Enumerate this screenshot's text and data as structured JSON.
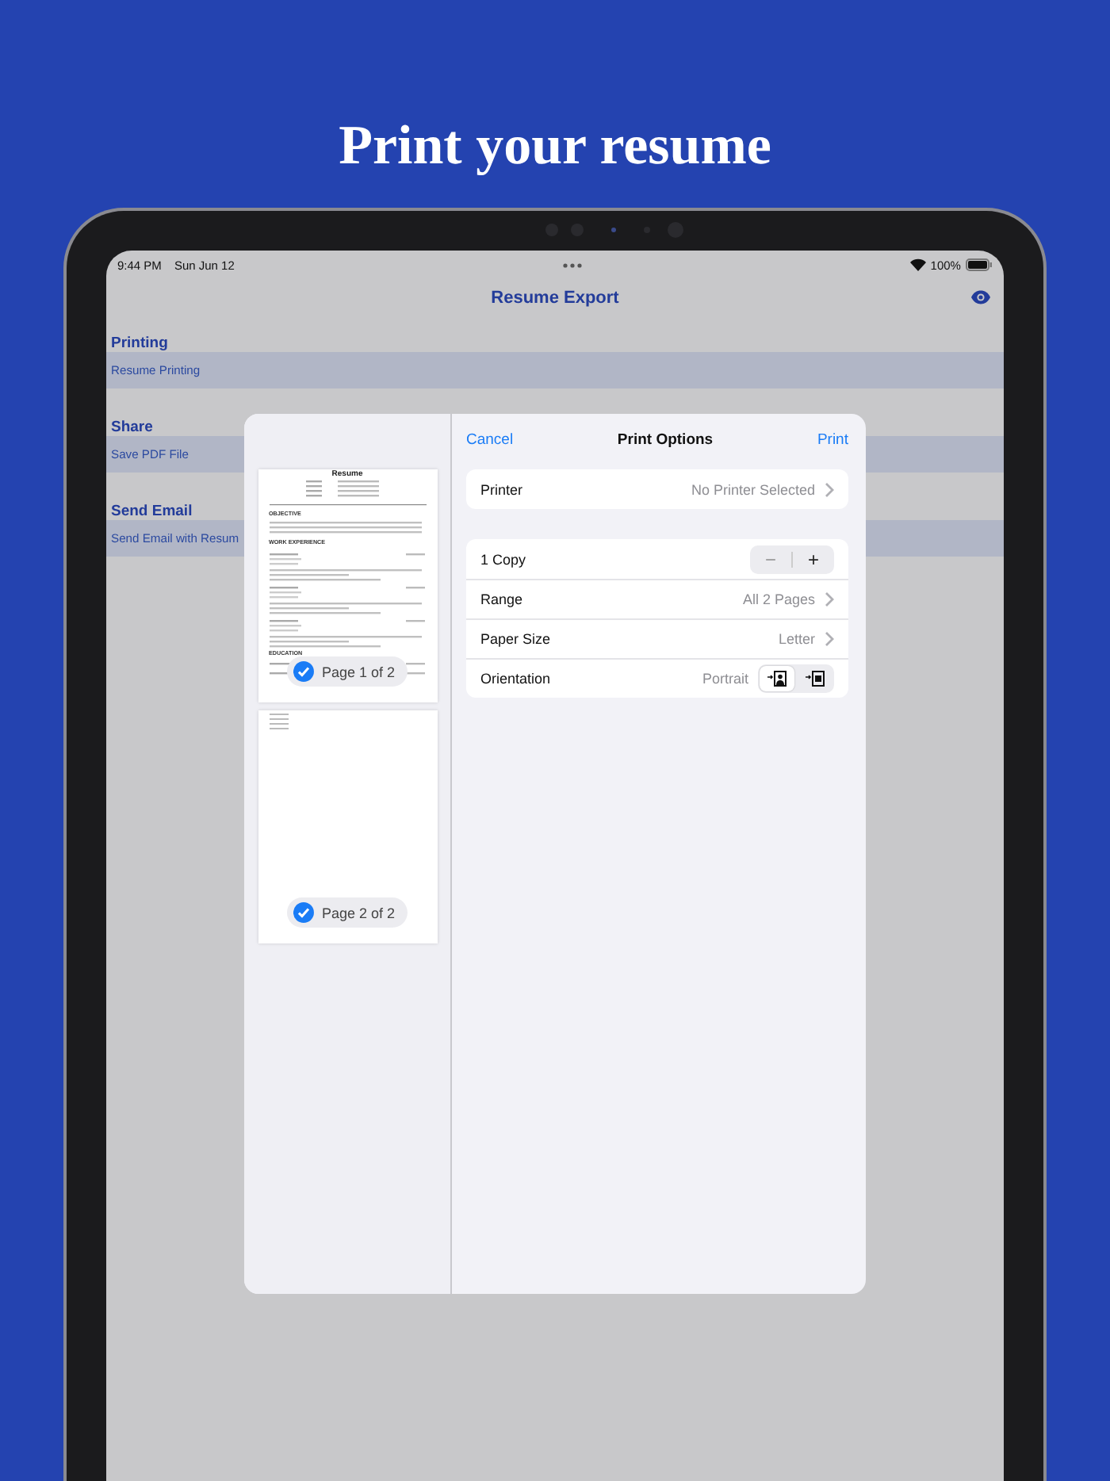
{
  "headline": "Print your resume",
  "status_bar": {
    "time": "9:44 PM",
    "date": "Sun Jun 12",
    "battery": "100%"
  },
  "nav": {
    "title": "Resume Export"
  },
  "sections": [
    {
      "header": "Printing",
      "rows": [
        {
          "label": "Resume Printing"
        }
      ]
    },
    {
      "header": "Share",
      "rows": [
        {
          "label": "Save PDF File"
        }
      ]
    },
    {
      "header": "Send Email",
      "rows": [
        {
          "label": "Send Email with Resum"
        }
      ]
    }
  ],
  "print_sheet": {
    "cancel": "Cancel",
    "title": "Print Options",
    "action": "Print",
    "pages": [
      {
        "kind": "resume",
        "label": "Page 1 of 2",
        "checked": true,
        "title": "Resume",
        "headings": [
          "OBJECTIVE",
          "WORK EXPERIENCE",
          "EDUCATION"
        ]
      },
      {
        "kind": "list",
        "label": "Page 2 of 2",
        "checked": true
      }
    ],
    "printer": {
      "label": "Printer",
      "value": "No Printer Selected"
    },
    "options": [
      {
        "kind": "stepper",
        "label": "1 Copy",
        "decrement": "−",
        "increment": "+"
      },
      {
        "kind": "link",
        "label": "Range",
        "value": "All 2 Pages"
      },
      {
        "kind": "link",
        "label": "Paper Size",
        "value": "Letter"
      },
      {
        "kind": "orientation",
        "label": "Orientation",
        "value": "Portrait",
        "choices": [
          {
            "selected": true
          },
          {
            "selected": false
          }
        ]
      }
    ]
  }
}
